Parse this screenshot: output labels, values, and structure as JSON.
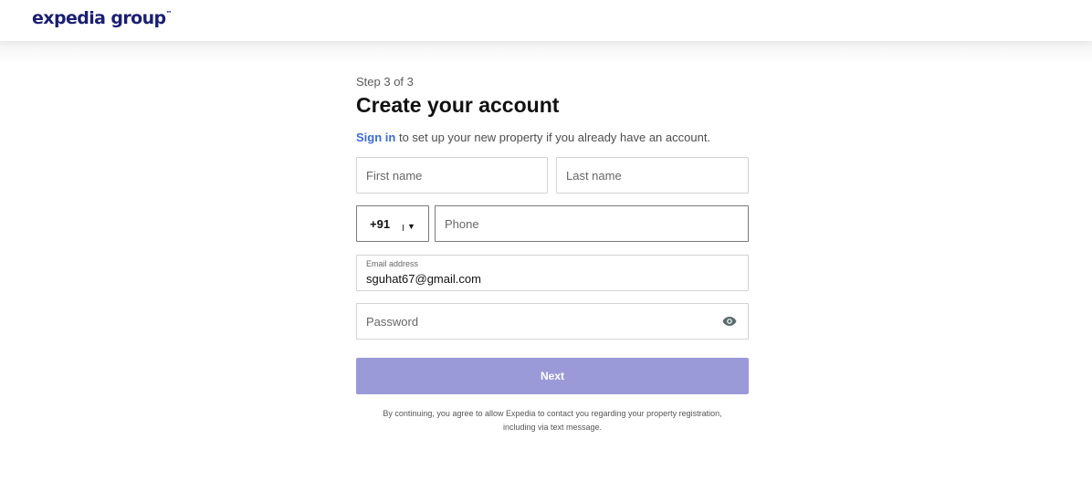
{
  "header": {
    "logo_text": "expedia group",
    "logo_mark": "™"
  },
  "form": {
    "step_text": "Step 3 of 3",
    "title": "Create your account",
    "signin_link": "Sign in",
    "subtitle_rest": " to set up your new property if you already have an account.",
    "first_name_placeholder": "First name",
    "last_name_placeholder": "Last name",
    "country_code": "+91",
    "phone_placeholder": "Phone",
    "email_label": "Email address",
    "email_value": "sguhat67@gmail.com",
    "password_placeholder": "Password",
    "next_label": "Next",
    "disclaimer_line1": "By continuing, you agree to allow Expedia to contact you regarding your property registration,",
    "disclaimer_line2": "including via text message."
  },
  "icons": {
    "caret": "chevron-down-icon",
    "eye": "eye-icon"
  },
  "colors": {
    "brand": "#1a1f71",
    "link": "#3d6bd4",
    "button": "#9a9ad8"
  }
}
